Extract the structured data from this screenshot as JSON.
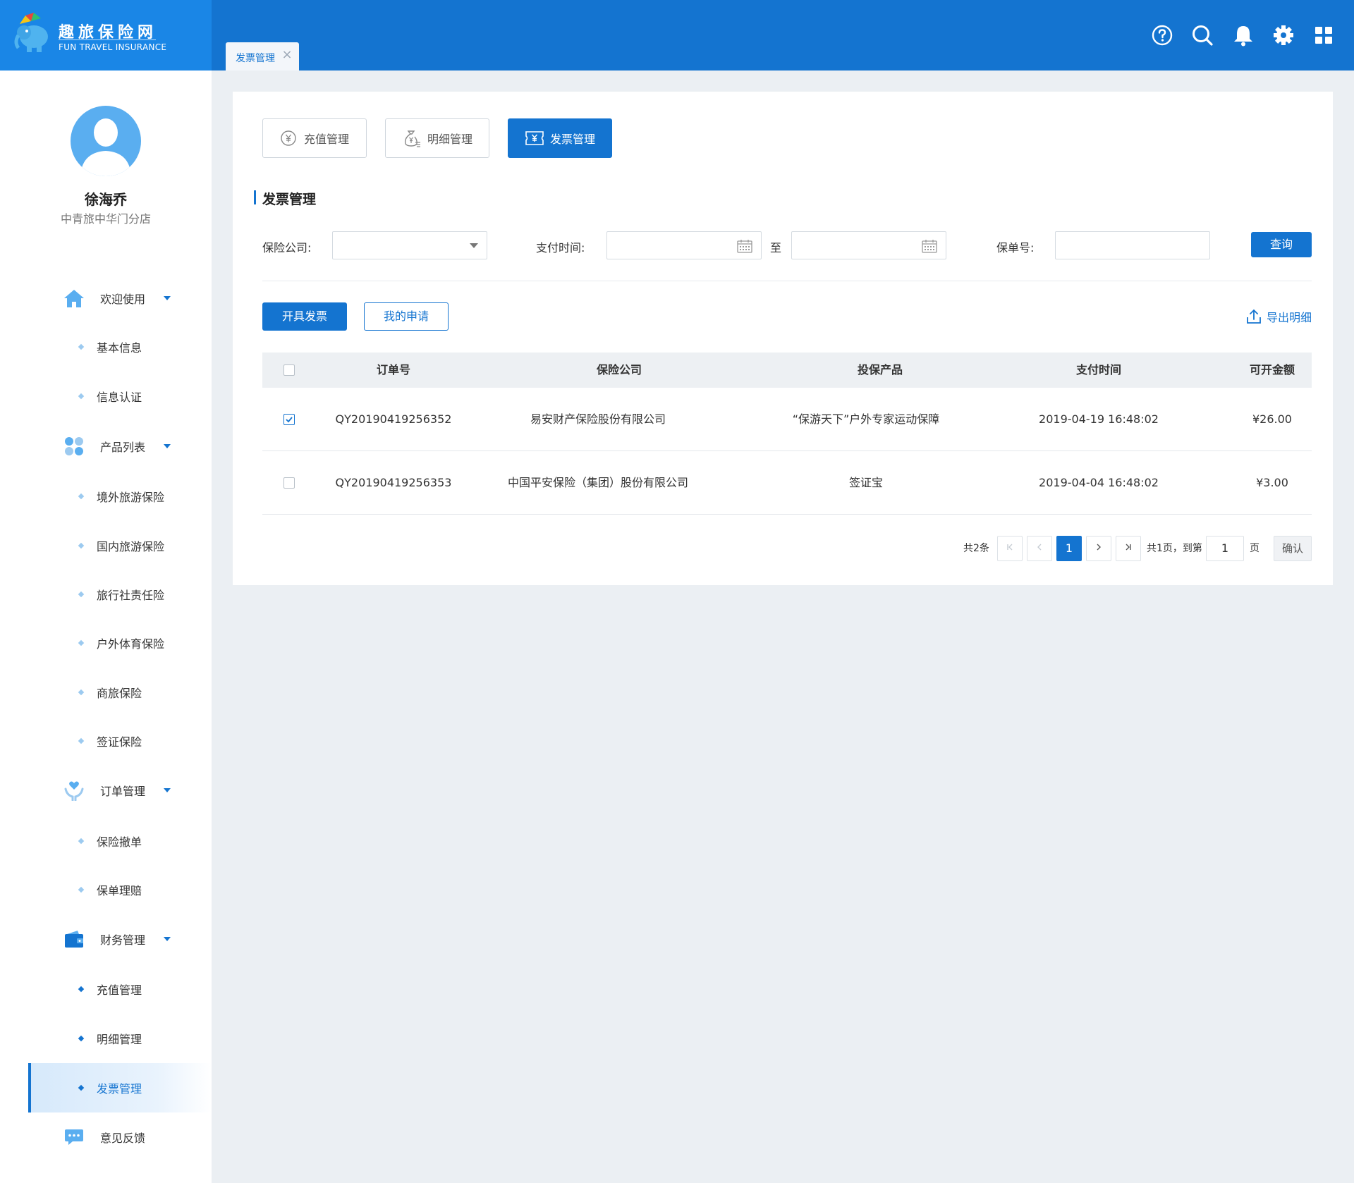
{
  "brand": {
    "title": "趣旅保险网",
    "subtitle": "FUN TRAVEL INSURANCE"
  },
  "header": {
    "open_tab": "发票管理",
    "icons": [
      "help-icon",
      "search-icon",
      "bell-icon",
      "gear-icon",
      "grid-icon"
    ]
  },
  "user": {
    "name": "徐海乔",
    "branch": "中青旅中华门分店"
  },
  "sidebar": {
    "groups": [
      {
        "label": "欢迎使用",
        "icon": "home-icon",
        "items": [
          "基本信息",
          "信息认证"
        ]
      },
      {
        "label": "产品列表",
        "icon": "apps-icon",
        "items": [
          "境外旅游保险",
          "国内旅游保险",
          "旅行社责任险",
          "户外体育保险",
          "商旅保险",
          "签证保险"
        ]
      },
      {
        "label": "订单管理",
        "icon": "heart-hand-icon",
        "items": [
          "保险撤单",
          "保单理赔"
        ]
      },
      {
        "label": "财务管理",
        "icon": "wallet-icon",
        "items": [
          "充值管理",
          "明细管理",
          "发票管理"
        ]
      },
      {
        "label": "意见反馈",
        "icon": "chat-icon",
        "items": []
      }
    ],
    "active_item": "发票管理"
  },
  "top_tabs": [
    {
      "label": "充值管理",
      "icon": "yen-coin-icon",
      "active": false
    },
    {
      "label": "明细管理",
      "icon": "money-bag-icon",
      "active": false
    },
    {
      "label": "发票管理",
      "icon": "ticket-icon",
      "active": true
    }
  ],
  "section_title": "发票管理",
  "filters": {
    "company_label": "保险公司:",
    "company_value": "",
    "pay_time_label": "支付时间:",
    "date_from": "",
    "date_sep": "至",
    "date_to": "",
    "policy_label": "保单号:",
    "policy_value": "",
    "query_button": "查询"
  },
  "actions": {
    "issue_invoice": "开具发票",
    "my_applications": "我的申请",
    "export": "导出明细"
  },
  "table": {
    "columns": [
      "订单号",
      "保险公司",
      "投保产品",
      "支付时间",
      "可开金额"
    ],
    "rows": [
      {
        "checked": true,
        "order_no": "QY20190419256352",
        "company": "易安财产保险股份有限公司",
        "product": "“保游天下”户外专家运动保障",
        "pay_time": "2019-04-19  16:48:02",
        "amount": "¥26.00"
      },
      {
        "checked": false,
        "order_no": "QY20190419256353",
        "company": "中国平安保险（集团）股份有限公司",
        "product": "签证宝",
        "pay_time": "2019-04-04  16:48:02",
        "amount": "¥3.00"
      }
    ]
  },
  "pagination": {
    "total": "共2条",
    "current_page": "1",
    "pages_text": "共1页，到第",
    "goto_value": "1",
    "page_unit": "页",
    "confirm": "确认"
  },
  "colors": {
    "primary": "#1474d0",
    "header": "#1474d0",
    "logo_bg": "#1a86e6",
    "page_bg": "#ebeff3"
  }
}
